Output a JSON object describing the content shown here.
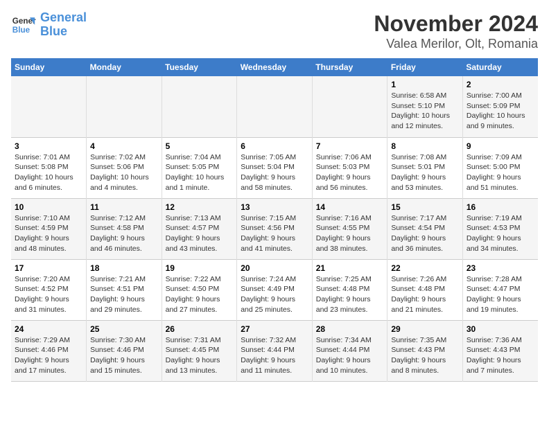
{
  "header": {
    "logo_line1": "General",
    "logo_line2": "Blue",
    "title": "November 2024",
    "subtitle": "Valea Merilor, Olt, Romania"
  },
  "weekdays": [
    "Sunday",
    "Monday",
    "Tuesday",
    "Wednesday",
    "Thursday",
    "Friday",
    "Saturday"
  ],
  "weeks": [
    [
      {
        "day": "",
        "text": ""
      },
      {
        "day": "",
        "text": ""
      },
      {
        "day": "",
        "text": ""
      },
      {
        "day": "",
        "text": ""
      },
      {
        "day": "",
        "text": ""
      },
      {
        "day": "1",
        "text": "Sunrise: 6:58 AM\nSunset: 5:10 PM\nDaylight: 10 hours and 12 minutes."
      },
      {
        "day": "2",
        "text": "Sunrise: 7:00 AM\nSunset: 5:09 PM\nDaylight: 10 hours and 9 minutes."
      }
    ],
    [
      {
        "day": "3",
        "text": "Sunrise: 7:01 AM\nSunset: 5:08 PM\nDaylight: 10 hours and 6 minutes."
      },
      {
        "day": "4",
        "text": "Sunrise: 7:02 AM\nSunset: 5:06 PM\nDaylight: 10 hours and 4 minutes."
      },
      {
        "day": "5",
        "text": "Sunrise: 7:04 AM\nSunset: 5:05 PM\nDaylight: 10 hours and 1 minute."
      },
      {
        "day": "6",
        "text": "Sunrise: 7:05 AM\nSunset: 5:04 PM\nDaylight: 9 hours and 58 minutes."
      },
      {
        "day": "7",
        "text": "Sunrise: 7:06 AM\nSunset: 5:03 PM\nDaylight: 9 hours and 56 minutes."
      },
      {
        "day": "8",
        "text": "Sunrise: 7:08 AM\nSunset: 5:01 PM\nDaylight: 9 hours and 53 minutes."
      },
      {
        "day": "9",
        "text": "Sunrise: 7:09 AM\nSunset: 5:00 PM\nDaylight: 9 hours and 51 minutes."
      }
    ],
    [
      {
        "day": "10",
        "text": "Sunrise: 7:10 AM\nSunset: 4:59 PM\nDaylight: 9 hours and 48 minutes."
      },
      {
        "day": "11",
        "text": "Sunrise: 7:12 AM\nSunset: 4:58 PM\nDaylight: 9 hours and 46 minutes."
      },
      {
        "day": "12",
        "text": "Sunrise: 7:13 AM\nSunset: 4:57 PM\nDaylight: 9 hours and 43 minutes."
      },
      {
        "day": "13",
        "text": "Sunrise: 7:15 AM\nSunset: 4:56 PM\nDaylight: 9 hours and 41 minutes."
      },
      {
        "day": "14",
        "text": "Sunrise: 7:16 AM\nSunset: 4:55 PM\nDaylight: 9 hours and 38 minutes."
      },
      {
        "day": "15",
        "text": "Sunrise: 7:17 AM\nSunset: 4:54 PM\nDaylight: 9 hours and 36 minutes."
      },
      {
        "day": "16",
        "text": "Sunrise: 7:19 AM\nSunset: 4:53 PM\nDaylight: 9 hours and 34 minutes."
      }
    ],
    [
      {
        "day": "17",
        "text": "Sunrise: 7:20 AM\nSunset: 4:52 PM\nDaylight: 9 hours and 31 minutes."
      },
      {
        "day": "18",
        "text": "Sunrise: 7:21 AM\nSunset: 4:51 PM\nDaylight: 9 hours and 29 minutes."
      },
      {
        "day": "19",
        "text": "Sunrise: 7:22 AM\nSunset: 4:50 PM\nDaylight: 9 hours and 27 minutes."
      },
      {
        "day": "20",
        "text": "Sunrise: 7:24 AM\nSunset: 4:49 PM\nDaylight: 9 hours and 25 minutes."
      },
      {
        "day": "21",
        "text": "Sunrise: 7:25 AM\nSunset: 4:48 PM\nDaylight: 9 hours and 23 minutes."
      },
      {
        "day": "22",
        "text": "Sunrise: 7:26 AM\nSunset: 4:48 PM\nDaylight: 9 hours and 21 minutes."
      },
      {
        "day": "23",
        "text": "Sunrise: 7:28 AM\nSunset: 4:47 PM\nDaylight: 9 hours and 19 minutes."
      }
    ],
    [
      {
        "day": "24",
        "text": "Sunrise: 7:29 AM\nSunset: 4:46 PM\nDaylight: 9 hours and 17 minutes."
      },
      {
        "day": "25",
        "text": "Sunrise: 7:30 AM\nSunset: 4:46 PM\nDaylight: 9 hours and 15 minutes."
      },
      {
        "day": "26",
        "text": "Sunrise: 7:31 AM\nSunset: 4:45 PM\nDaylight: 9 hours and 13 minutes."
      },
      {
        "day": "27",
        "text": "Sunrise: 7:32 AM\nSunset: 4:44 PM\nDaylight: 9 hours and 11 minutes."
      },
      {
        "day": "28",
        "text": "Sunrise: 7:34 AM\nSunset: 4:44 PM\nDaylight: 9 hours and 10 minutes."
      },
      {
        "day": "29",
        "text": "Sunrise: 7:35 AM\nSunset: 4:43 PM\nDaylight: 9 hours and 8 minutes."
      },
      {
        "day": "30",
        "text": "Sunrise: 7:36 AM\nSunset: 4:43 PM\nDaylight: 9 hours and 7 minutes."
      }
    ]
  ]
}
